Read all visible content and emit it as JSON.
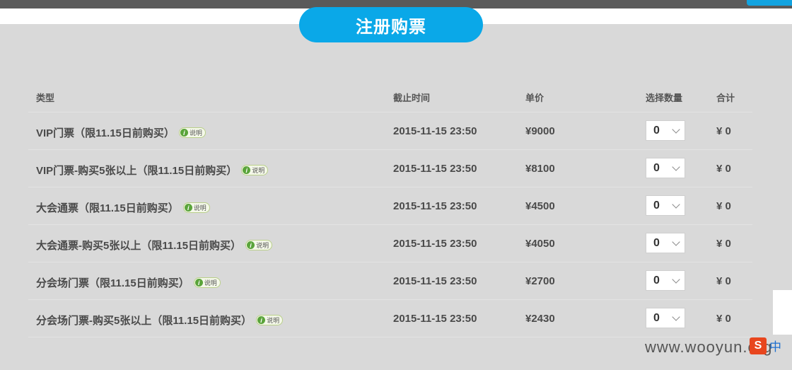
{
  "header": {
    "register_button": "注册购票"
  },
  "table": {
    "columns": {
      "type": "类型",
      "deadline": "截止时间",
      "price": "单价",
      "quantity": "选择数量",
      "total": "合计"
    },
    "info_label": "说明",
    "info_icon": "i",
    "rows": [
      {
        "type": "VIP门票（限11.15日前购买）",
        "deadline": "2015-11-15 23:50",
        "price": "¥9000",
        "qty": "0",
        "total": "¥ 0"
      },
      {
        "type": "VIP门票-购买5张以上（限11.15日前购买）",
        "deadline": "2015-11-15 23:50",
        "price": "¥8100",
        "qty": "0",
        "total": "¥ 0"
      },
      {
        "type": "大会通票（限11.15日前购买）",
        "deadline": "2015-11-15 23:50",
        "price": "¥4500",
        "qty": "0",
        "total": "¥ 0"
      },
      {
        "type": "大会通票-购买5张以上（限11.15日前购买）",
        "deadline": "2015-11-15 23:50",
        "price": "¥4050",
        "qty": "0",
        "total": "¥ 0"
      },
      {
        "type": "分会场门票（限11.15日前购买）",
        "deadline": "2015-11-15 23:50",
        "price": "¥2700",
        "qty": "0",
        "total": "¥ 0"
      },
      {
        "type": "分会场门票-购买5张以上（限11.15日前购买）",
        "deadline": "2015-11-15 23:50",
        "price": "¥2430",
        "qty": "0",
        "total": "¥ 0"
      }
    ]
  },
  "overlay": {
    "watermark": "www.wooyun.org",
    "ime_logo": "S",
    "ime_mode": "中"
  },
  "colors": {
    "accent": "#0aa8e8",
    "background": "#d9d9d9",
    "info_green": "#5aa43a"
  }
}
